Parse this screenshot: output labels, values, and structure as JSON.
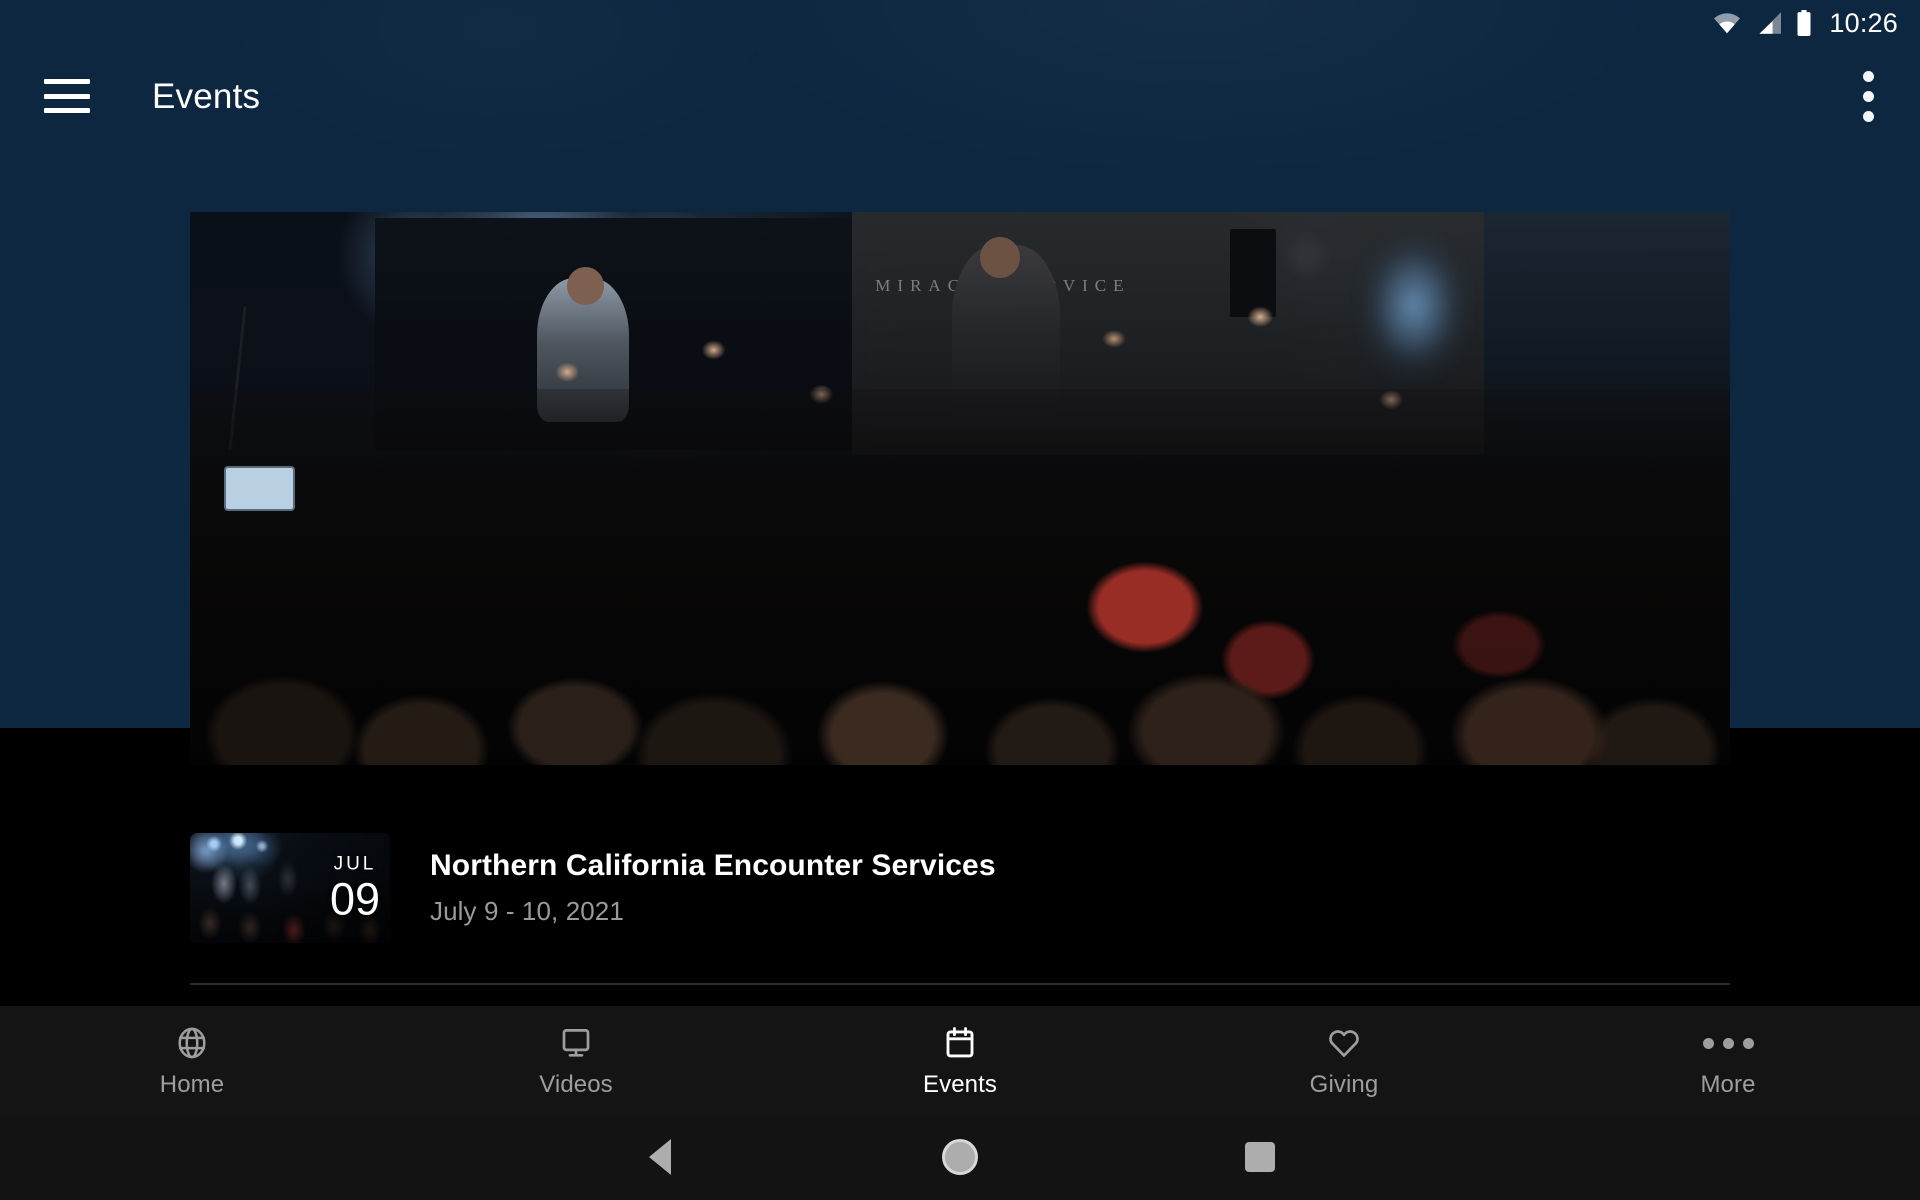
{
  "status_bar": {
    "time": "10:26",
    "icons": [
      "wifi-icon",
      "cellular-signal-icon",
      "battery-icon"
    ]
  },
  "app_bar": {
    "menu_icon": "hamburger-menu-icon",
    "title": "Events",
    "overflow_icon": "overflow-menu-icon"
  },
  "hero": {
    "alt": "Worship service with congregation raising hands",
    "screen_text": "MIRACLE SERVICE"
  },
  "events": [
    {
      "month": "JUL",
      "day": "09",
      "title": "Northern California Encounter Services",
      "date_range": "July 9 - 10, 2021"
    }
  ],
  "tab_bar": {
    "active": "Events",
    "items": [
      {
        "label": "Home",
        "icon": "globe-icon"
      },
      {
        "label": "Videos",
        "icon": "monitor-icon"
      },
      {
        "label": "Events",
        "icon": "calendar-icon"
      },
      {
        "label": "Giving",
        "icon": "heart-icon"
      },
      {
        "label": "More",
        "icon": "ellipsis-icon"
      }
    ]
  },
  "system_nav": {
    "back": "back-button",
    "home": "home-button",
    "recents": "recents-button"
  },
  "colors": {
    "app_background": "#0d2740",
    "content_background": "#000000",
    "tab_bar_background": "#141414",
    "accent_text": "#ffffff",
    "muted_text": "#9a9a9a"
  }
}
